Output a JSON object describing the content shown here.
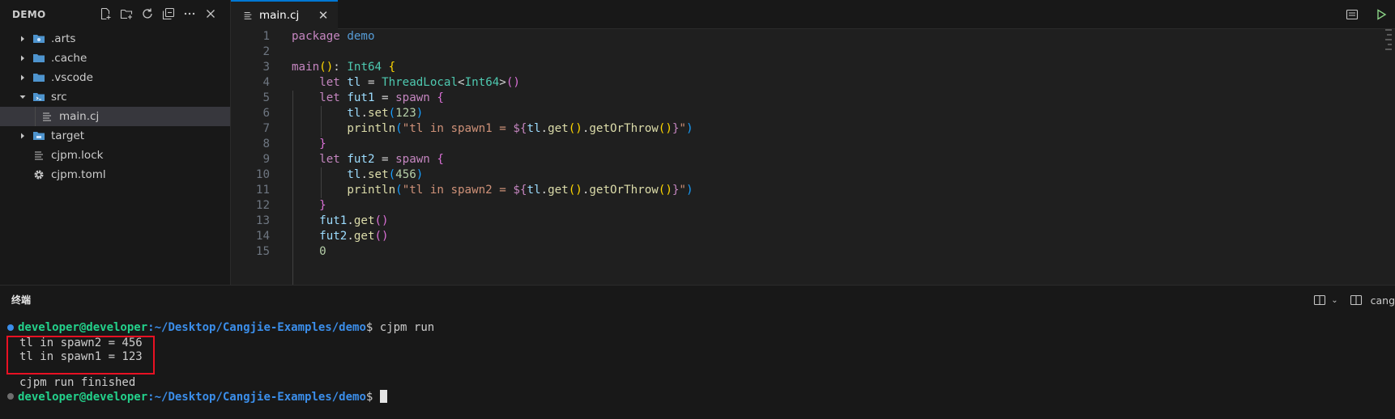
{
  "explorer": {
    "title": "DEMO",
    "actions": [
      "new-file-icon",
      "new-folder-icon",
      "refresh-icon",
      "collapse-all-icon",
      "more-icon",
      "close-icon"
    ],
    "items": [
      {
        "label": ".arts",
        "type": "folder",
        "expanded": false
      },
      {
        "label": ".cache",
        "type": "folder",
        "expanded": false
      },
      {
        "label": ".vscode",
        "type": "folder",
        "expanded": false
      },
      {
        "label": "src",
        "type": "folder",
        "expanded": true
      },
      {
        "label": "main.cj",
        "type": "file",
        "selected": true
      },
      {
        "label": "target",
        "type": "folder",
        "expanded": false
      },
      {
        "label": "cjpm.lock",
        "type": "file"
      },
      {
        "label": "cjpm.toml",
        "type": "settings-file"
      }
    ]
  },
  "editor": {
    "tab_label": "main.cj",
    "line_numbers": [
      "1",
      "2",
      "3",
      "4",
      "5",
      "6",
      "7",
      "8",
      "9",
      "10",
      "11",
      "12",
      "13",
      "14",
      "15"
    ],
    "colors": {
      "accent": "#0078d4",
      "keyword": "#c586c0",
      "type": "#4ec9b0",
      "string": "#ce9178"
    }
  },
  "panel": {
    "title": "终端",
    "terminal_name": "cang",
    "prompt_user": "developer@developer",
    "prompt_path": ":~/Desktop/Cangjie-Examples/demo",
    "prompt_suffix": "$",
    "command": " cjpm run",
    "output_line_1": "tl in spawn2 = 456",
    "output_line_2": "tl in spawn1 = 123",
    "finished_line": "cjpm run finished",
    "highlight_color": "#e81123"
  }
}
